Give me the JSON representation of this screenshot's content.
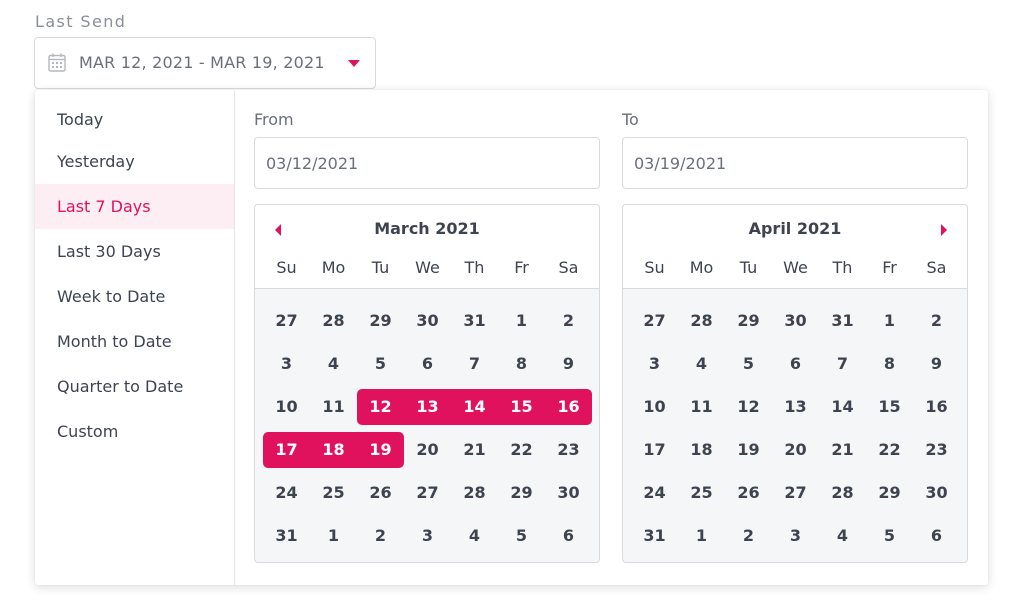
{
  "field": {
    "label": "Last Send",
    "range_text": "MAR 12, 2021 - MAR 19, 2021"
  },
  "presets": [
    "Today",
    "Yesterday",
    "Last 7 Days",
    "Last 30 Days",
    "Week to Date",
    "Month to Date",
    "Quarter to Date",
    "Custom"
  ],
  "active_preset": "Last 7 Days",
  "from": {
    "label": "From",
    "value": "03/12/2021"
  },
  "to": {
    "label": "To",
    "value": "03/19/2021"
  },
  "weekdays": [
    "Su",
    "Mo",
    "Tu",
    "We",
    "Th",
    "Fr",
    "Sa"
  ],
  "accent_color": "#e0125e",
  "calendars": [
    {
      "title": "March 2021",
      "nav": "prev",
      "weeks": [
        [
          "27",
          "28",
          "29",
          "30",
          "31",
          "1",
          "2"
        ],
        [
          "3",
          "4",
          "5",
          "6",
          "7",
          "8",
          "9"
        ],
        [
          "10",
          "11",
          "12",
          "13",
          "14",
          "15",
          "16"
        ],
        [
          "17",
          "18",
          "19",
          "20",
          "21",
          "22",
          "23"
        ],
        [
          "24",
          "25",
          "26",
          "27",
          "28",
          "29",
          "30"
        ],
        [
          "31",
          "1",
          "2",
          "3",
          "4",
          "5",
          "6"
        ]
      ],
      "selected_days": [
        "12",
        "13",
        "14",
        "15",
        "16",
        "17",
        "18",
        "19"
      ]
    },
    {
      "title": "April 2021",
      "nav": "next",
      "weeks": [
        [
          "27",
          "28",
          "29",
          "30",
          "31",
          "1",
          "2"
        ],
        [
          "3",
          "4",
          "5",
          "6",
          "7",
          "8",
          "9"
        ],
        [
          "10",
          "11",
          "12",
          "13",
          "14",
          "15",
          "16"
        ],
        [
          "17",
          "18",
          "19",
          "20",
          "21",
          "22",
          "23"
        ],
        [
          "24",
          "25",
          "26",
          "27",
          "28",
          "29",
          "30"
        ],
        [
          "31",
          "1",
          "2",
          "3",
          "4",
          "5",
          "6"
        ]
      ],
      "selected_days": []
    }
  ]
}
